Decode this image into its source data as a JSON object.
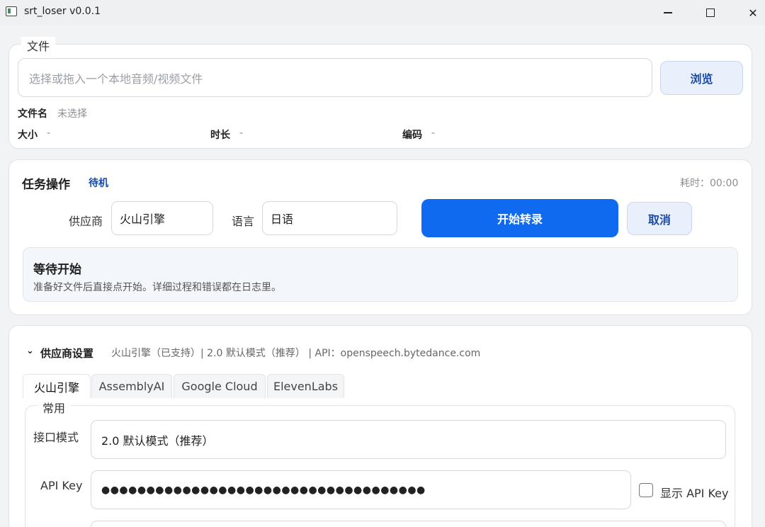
{
  "window": {
    "title": "srt_loser v0.0.1"
  },
  "file": {
    "legend": "文件",
    "placeholder": "选择或拖入一个本地音频/视频文件",
    "browse_label": "浏览",
    "name_label": "文件名",
    "name_value": "未选择",
    "size_label": "大小",
    "size_value": "-",
    "duration_label": "时长",
    "duration_value": "-",
    "codec_label": "编码",
    "codec_value": "-"
  },
  "task": {
    "title": "任务操作",
    "status": "待机",
    "elapsed": "耗时：00:00",
    "provider_label": "供应商",
    "provider_value": "火山引擎",
    "language_label": "语言",
    "language_value": "日语",
    "start_label": "开始转录",
    "cancel_label": "取消",
    "panel_heading": "等待开始",
    "panel_desc": "准备好文件后直接点开始。详细过程和错误都在日志里。"
  },
  "provider": {
    "chevron": "⌄",
    "title": "供应商设置",
    "summary": "火山引擎（已支持）| 2.0 默认模式（推荐） | API：openspeech.bytedance.com",
    "tabs": [
      {
        "label": "火山引擎"
      },
      {
        "label": "AssemblyAI"
      },
      {
        "label": "Google Cloud"
      },
      {
        "label": "ElevenLabs"
      }
    ],
    "group_legend": "常用",
    "mode_label": "接口模式",
    "mode_value": "2.0 默认模式（推荐）",
    "api_key_label": "API Key",
    "api_key_value": "●●●●●●●●●●●●●●●●●●●●●●●●●●●●●●●●●●●●",
    "show_key_label": "显示 API Key"
  },
  "colors": {
    "accent": "#0f6af0",
    "accent_text": "#1a4aa6",
    "secondary_bg": "#e9f0fb"
  }
}
